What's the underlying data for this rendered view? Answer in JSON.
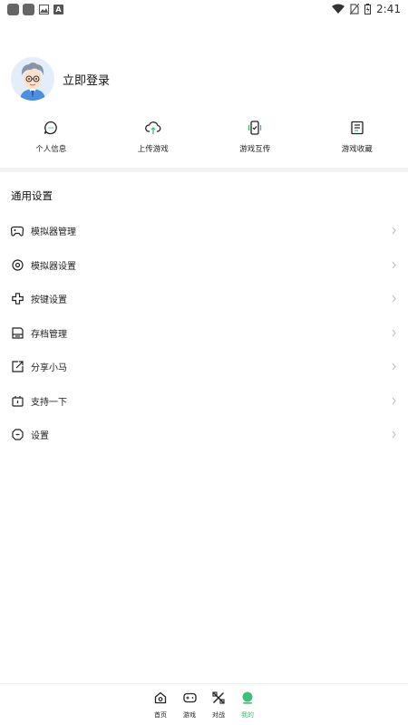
{
  "status_bar": {
    "time": "2:41",
    "notification_icons": [
      "app-icon",
      "app-icon",
      "image-icon",
      "a-icon"
    ],
    "system_icons": [
      "wifi-icon",
      "no-sim-icon",
      "battery-icon"
    ]
  },
  "profile": {
    "login_label": "立即登录",
    "avatar_icon": "avatar"
  },
  "quick_actions": [
    {
      "label": "个人信息",
      "icon": "chat-bubble-icon"
    },
    {
      "label": "上传游戏",
      "icon": "cloud-upload-icon"
    },
    {
      "label": "游戏互传",
      "icon": "phone-transfer-icon"
    },
    {
      "label": "游戏收藏",
      "icon": "list-icon"
    }
  ],
  "settings": {
    "title": "通用设置",
    "items": [
      {
        "label": "模拟器管理",
        "icon": "gamepad-icon"
      },
      {
        "label": "模拟器设置",
        "icon": "gear-icon"
      },
      {
        "label": "按键设置",
        "icon": "dpad-icon"
      },
      {
        "label": "存档管理",
        "icon": "save-icon"
      },
      {
        "label": "分享小马",
        "icon": "share-icon"
      },
      {
        "label": "支持一下",
        "icon": "tv-icon"
      },
      {
        "label": "设置",
        "icon": "settings-icon"
      }
    ]
  },
  "bottom_nav": [
    {
      "label": "首页",
      "icon": "home-icon",
      "active": false
    },
    {
      "label": "游戏",
      "icon": "gamepad-icon",
      "active": false
    },
    {
      "label": "对战",
      "icon": "battle-icon",
      "active": false
    },
    {
      "label": "我的",
      "icon": "profile-dot-icon",
      "active": true
    }
  ],
  "colors": {
    "accent": "#3dbf7a",
    "icon_stroke": "#222222",
    "chevron": "#bbbbbb"
  }
}
